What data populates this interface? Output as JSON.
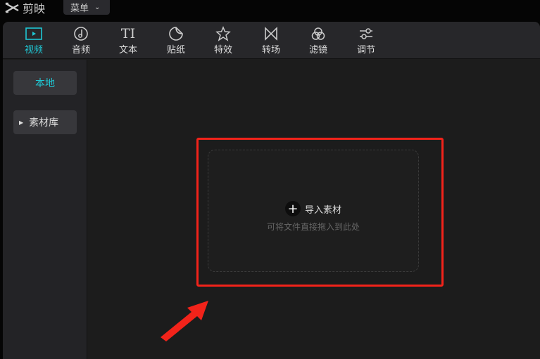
{
  "app": {
    "title": "剪映",
    "menu_label": "菜单"
  },
  "toolbar": {
    "items": [
      {
        "label": "视频",
        "icon": "video-icon",
        "active": true
      },
      {
        "label": "音频",
        "icon": "music-icon"
      },
      {
        "label": "文本",
        "icon": "text-icon"
      },
      {
        "label": "贴纸",
        "icon": "sticker-icon"
      },
      {
        "label": "特效",
        "icon": "effects-icon"
      },
      {
        "label": "转场",
        "icon": "transition-icon"
      },
      {
        "label": "滤镜",
        "icon": "filter-icon"
      },
      {
        "label": "调节",
        "icon": "adjust-icon"
      }
    ]
  },
  "sidebar": {
    "local": "本地",
    "library": "素材库"
  },
  "dropzone": {
    "import_label": "导入素材",
    "hint": "可将文件直接拖入到此处"
  },
  "colors": {
    "accent": "#1fc7d4",
    "highlight": "#f2231a"
  }
}
